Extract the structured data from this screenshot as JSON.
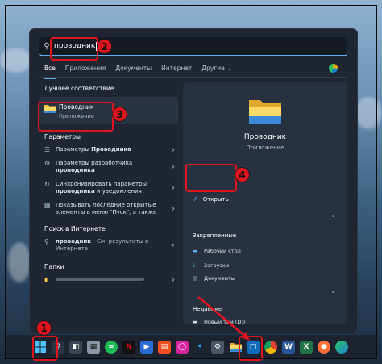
{
  "search": {
    "query": "проводник"
  },
  "tabs": [
    {
      "label": "Все",
      "active": true
    },
    {
      "label": "Приложения"
    },
    {
      "label": "Документы"
    },
    {
      "label": "Интернет"
    },
    {
      "label": "Другие"
    }
  ],
  "left": {
    "best_match_heading": "Лучшее соответствие",
    "best_match": {
      "title": "Проводник",
      "subtitle": "Приложение"
    },
    "settings_heading": "Параметры",
    "settings": [
      {
        "pre": "Параметры ",
        "bold": "Проводника"
      },
      {
        "pre": "Параметры разработчика ",
        "bold": "проводника"
      },
      {
        "line1": "Синхронизировать параметры",
        "bold": "проводника",
        "post": " и уведомления"
      },
      {
        "line1": "Показывать последние открытые",
        "line2": "элементы в меню \"Пуск\", а также"
      }
    ],
    "web_heading": "Поиск в Интернете",
    "web": {
      "bold": "проводник",
      "post": " - См. результаты в Интернете"
    },
    "folders_heading": "Папки"
  },
  "right": {
    "title": "Проводник",
    "subtitle": "Приложение",
    "open_label": "Открыть",
    "pinned_heading": "Закрепленные",
    "pinned": [
      "Рабочий стол",
      "Загрузки",
      "Документы"
    ],
    "recent_heading": "Недавние",
    "recent": [
      {
        "label": "Новый том (D:)"
      }
    ]
  },
  "callouts": [
    "1",
    "2",
    "3",
    "4"
  ],
  "colors": {
    "accent": "#5fb2f2",
    "callout": "#e0141e",
    "folder": "#f4c542"
  }
}
